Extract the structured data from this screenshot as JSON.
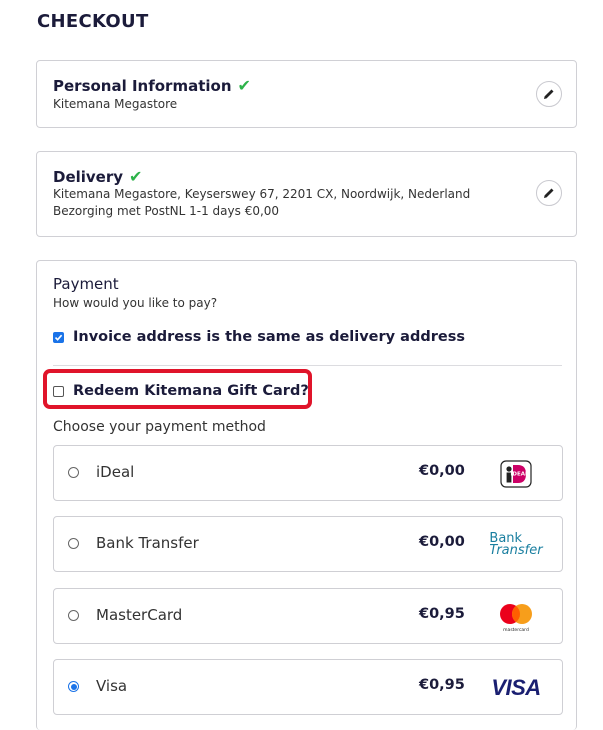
{
  "page_title": "CHECKOUT",
  "personal": {
    "heading": "Personal Information",
    "detail": "Kitemana Megastore"
  },
  "delivery": {
    "heading": "Delivery",
    "address": "Kitemana Megastore, Keyserswey 67, 2201 CX, Noordwijk, Nederland",
    "method": "Bezorging met PostNL 1-1 days €0,00"
  },
  "payment": {
    "heading": "Payment",
    "subheading": "How would you like to pay?",
    "same_address_label": "Invoice address is the same as delivery address",
    "same_address_checked": true,
    "gift_card_label": "Redeem Kitemana Gift Card?",
    "gift_card_checked": false,
    "choose_label": "Choose your payment method",
    "methods": [
      {
        "name": "iDeal",
        "price": "€0,00",
        "logo": "ideal-logo",
        "selected": false
      },
      {
        "name": "Bank Transfer",
        "price": "€0,00",
        "logo": "bank-transfer-logo",
        "logo_text_1": "Bank",
        "logo_text_2": "Transfer",
        "selected": false
      },
      {
        "name": "MasterCard",
        "price": "€0,95",
        "logo": "mastercard-logo",
        "logo_text": "mastercard",
        "selected": false
      },
      {
        "name": "Visa",
        "price": "€0,95",
        "logo": "visa-logo",
        "logo_text": "VISA",
        "selected": true
      }
    ]
  },
  "colors": {
    "check_green": "#2db34a",
    "accent_blue": "#1a73e8",
    "highlight_red": "#e0142a",
    "ideal_pink": "#cc0066",
    "visa_navy": "#1a1f71"
  }
}
